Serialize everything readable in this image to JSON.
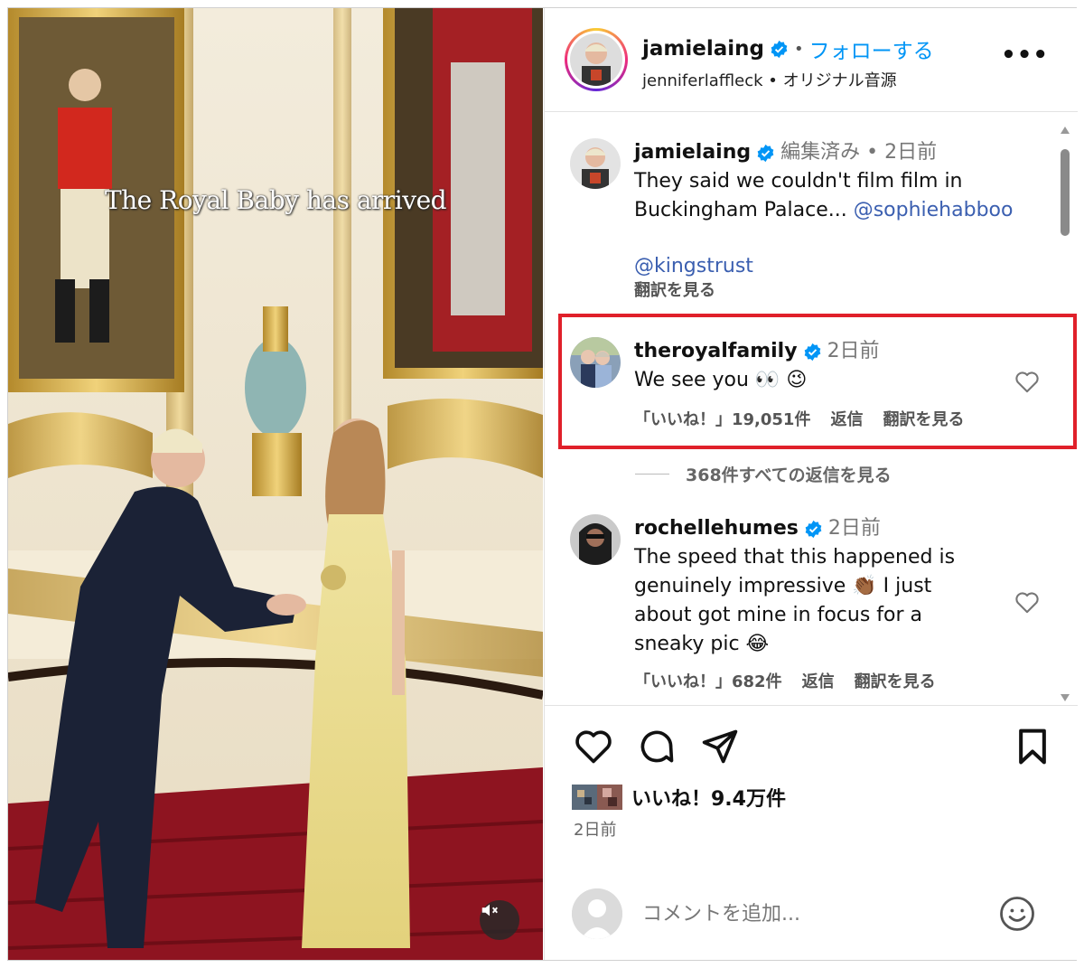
{
  "media": {
    "overlay_text": "The Royal Baby has arrived"
  },
  "header": {
    "username": "jamielaing",
    "separator": "•",
    "follow_label": "フォローする",
    "audio": "jenniferlaffleck • オリジナル音源",
    "more_label": "•••"
  },
  "comments": [
    {
      "username": "jamielaing",
      "meta": "編集済み • 2日前",
      "text_line1": "They said we couldn't film film in",
      "text_line2_prefix": "Buckingham Palace... ",
      "mention1": "@sophiehabboo",
      "mention2": "@kingstrust",
      "translate": "翻訳を見る"
    },
    {
      "username": "theroyalfamily",
      "meta": "2日前",
      "text": "We see you 👀 😉",
      "likes": "「いいね！」19,051件",
      "reply": "返信",
      "translate": "翻訳を見る"
    },
    {
      "username": "rochellehumes",
      "meta": "2日前",
      "text_lines": [
        "The speed that this happened is",
        "genuinely impressive 👏🏾 I just",
        "about got mine in focus for a",
        "sneaky pic 😂"
      ],
      "likes": "「いいね！」682件",
      "reply": "返信",
      "translate": "翻訳を見る"
    }
  ],
  "view_replies": "368件すべての返信を見る",
  "likes_summary": "いいね！9.4万件",
  "post_date": "2日前",
  "comment_input": {
    "placeholder": "コメントを追加..."
  },
  "icons": [
    "heart-icon",
    "comment-icon",
    "share-icon",
    "bookmark-icon",
    "emoji-icon",
    "mute-icon",
    "verified-icon"
  ],
  "colors": {
    "accent_blue": "#0095f6",
    "highlight_red": "#e0202a"
  }
}
